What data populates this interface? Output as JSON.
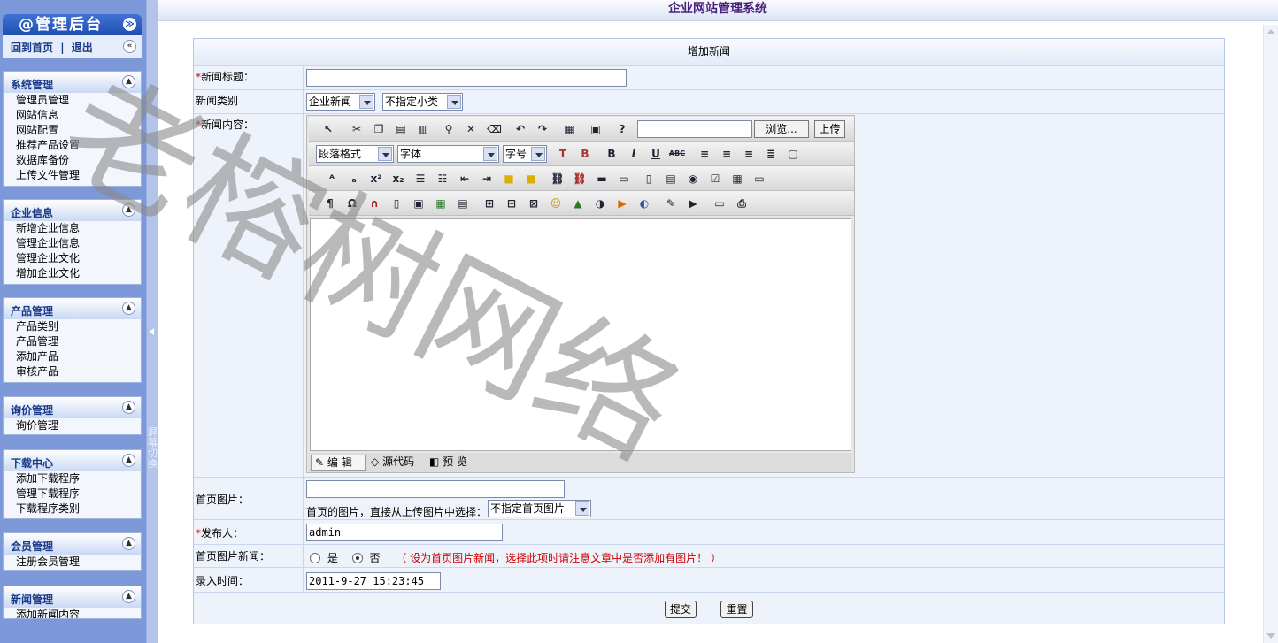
{
  "sidebar": {
    "brand": "@管理后台",
    "brand_toggle": "≫",
    "home_link": "回到首页",
    "logout_link": "退出",
    "separator": "|",
    "collapse_toggle": "«",
    "strip_text": "屏幕切换",
    "sections": [
      {
        "title": "系统管理",
        "items": [
          "管理员管理",
          "网站信息",
          "网站配置",
          "推荐产品设置",
          "数据库备份",
          "上传文件管理"
        ]
      },
      {
        "title": "企业信息",
        "items": [
          "新增企业信息",
          "管理企业信息",
          "管理企业文化",
          "增加企业文化"
        ]
      },
      {
        "title": "产品管理",
        "items": [
          "产品类别",
          "产品管理",
          "添加产品",
          "审核产品"
        ]
      },
      {
        "title": "询价管理",
        "items": [
          "询价管理"
        ]
      },
      {
        "title": "下载中心",
        "items": [
          "添加下载程序",
          "管理下载程序",
          "下载程序类别"
        ]
      },
      {
        "title": "会员管理",
        "items": [
          "注册会员管理"
        ]
      },
      {
        "title": "新闻管理",
        "items": [
          "添加新闻内容"
        ]
      }
    ]
  },
  "header": {
    "title": "企业网站管理系统"
  },
  "form": {
    "title": "增加新闻",
    "required_mark": "*",
    "news_title_label": "新闻标题：",
    "news_title_value": "",
    "category_label": "新闻类别",
    "category_value": "企业新闻",
    "subcategory_value": "不指定小类",
    "content_label": "新闻内容：",
    "editor": {
      "upload_path": "",
      "browse_button": "浏览...",
      "upload_button": "上传",
      "paragraph_select": "段落格式",
      "font_select": "字体",
      "size_select": "字号",
      "bold": "B",
      "italic": "I",
      "underline": "U",
      "strike": "ABC",
      "tabs": [
        "编 辑",
        "源代码",
        "预 览"
      ]
    },
    "home_image_label": "首页图片：",
    "home_image_value": "",
    "home_image_hint": "首页的图片，直接从上传图片中选择：",
    "home_image_select": "不指定首页图片",
    "publisher_label": "发布人：",
    "publisher_value": "admin",
    "home_news_label": "首页图片新闻：",
    "yes": "是",
    "no": "否",
    "home_news_selected": "否",
    "home_news_warning": "（ 设为首页图片新闻，选择此项时请注意文章中是否添加有图片！ ）",
    "time_label": "录入时间：",
    "time_value": "2011-9-27 15:23:45",
    "submit": "提交",
    "reset": "重置"
  },
  "watermark": "老榕树网络",
  "colors": {
    "sidebar": "#7c98d8",
    "required": "#dd0000",
    "warning": "#cc0000",
    "title": "#4a1f7a"
  }
}
